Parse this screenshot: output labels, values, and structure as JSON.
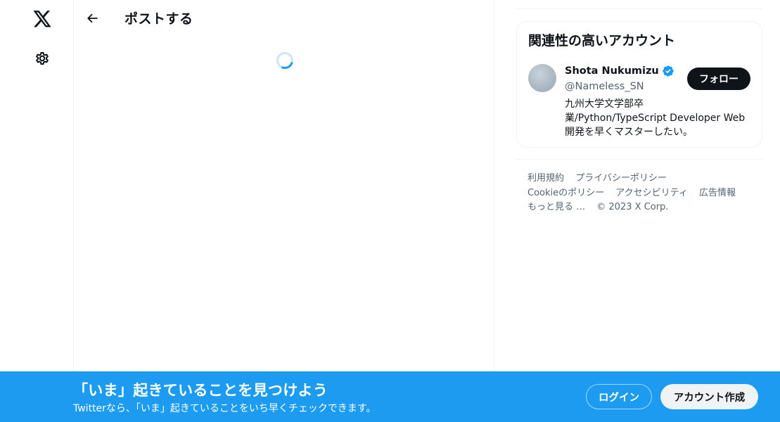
{
  "nav": {
    "logo_icon": "x-logo-icon",
    "settings_icon": "gear-icon"
  },
  "header": {
    "back_icon": "arrow-left-icon",
    "title": "ポストする"
  },
  "main": {
    "loading_icon": "spinner-icon"
  },
  "related": {
    "title": "関連性の高いアカウント",
    "account": {
      "name": "Shota Nukumizu",
      "handle": "@Nameless_SN",
      "verified": true,
      "follow_label": "フォロー",
      "bio_lines": [
        "九州大学文学部卒",
        "業/Python/TypeScript Developer Web",
        "開発を早くマスターしたい。"
      ]
    }
  },
  "footer": {
    "row1": [
      "利用規約",
      "プライバシーポリシー"
    ],
    "row2": [
      "Cookieのポリシー",
      "アクセシビリティ",
      "広告情報"
    ],
    "row3": [
      "もっと見る …",
      "© 2023 X Corp."
    ]
  },
  "banner": {
    "title": "「いま」起きていることを見つけよう",
    "subtitle": "Twitterなら、「いま」起きていることをいち早くチェックできます。",
    "login_label": "ログイン",
    "signup_label": "アカウント作成"
  },
  "colors": {
    "accent": "#1d9bf0",
    "text_primary": "#0f1419",
    "text_secondary": "#536471",
    "border": "#eff3f4"
  }
}
